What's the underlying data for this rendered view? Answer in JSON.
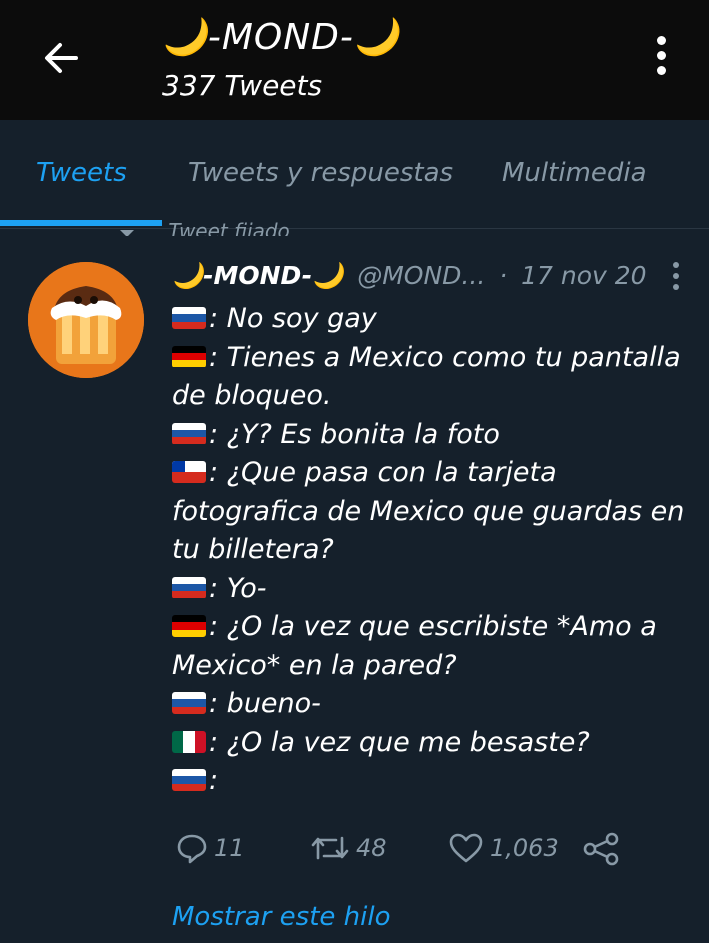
{
  "profile": {
    "display_name": "🌙-MOND-🌙",
    "tweet_count_label": "337 Tweets"
  },
  "tabs": [
    {
      "label": "Tweets",
      "active": true
    },
    {
      "label": "Tweets y respuestas",
      "active": false
    },
    {
      "label": "Multimedia",
      "active": false
    }
  ],
  "pinned_label": "Tweet fijado",
  "tweet": {
    "author_name": "🌙-MOND-🌙",
    "handle": "@MOND...",
    "separator": "·",
    "date": "17 nov 20",
    "lines": [
      {
        "flag": "russia",
        "text": ": No soy gay"
      },
      {
        "flag": "germany",
        "text": ": Tienes a Mexico como tu pantalla de bloqueo."
      },
      {
        "flag": "russia",
        "text": ": ¿Y? Es bonita la foto"
      },
      {
        "flag": "chile",
        "text": ": ¿Que pasa con la tarjeta fotografica de Mexico que guardas en tu billetera?"
      },
      {
        "flag": "russia",
        "text": ": Yo-"
      },
      {
        "flag": "germany",
        "text": ": ¿O la vez que escribiste *Amo a Mexico* en la pared?"
      },
      {
        "flag": "russia",
        "text": ": bueno-"
      },
      {
        "flag": "mexico",
        "text": ": ¿O la vez que me besaste?"
      },
      {
        "flag": "russia",
        "text": ":"
      }
    ],
    "replies": "11",
    "retweets": "48",
    "likes": "1,063"
  },
  "show_thread_label": "Mostrar este hilo",
  "colors": {
    "background": "#15202b",
    "topbar": "#0c0c0c",
    "accent": "#1da1f2",
    "muted": "#8899a6"
  }
}
